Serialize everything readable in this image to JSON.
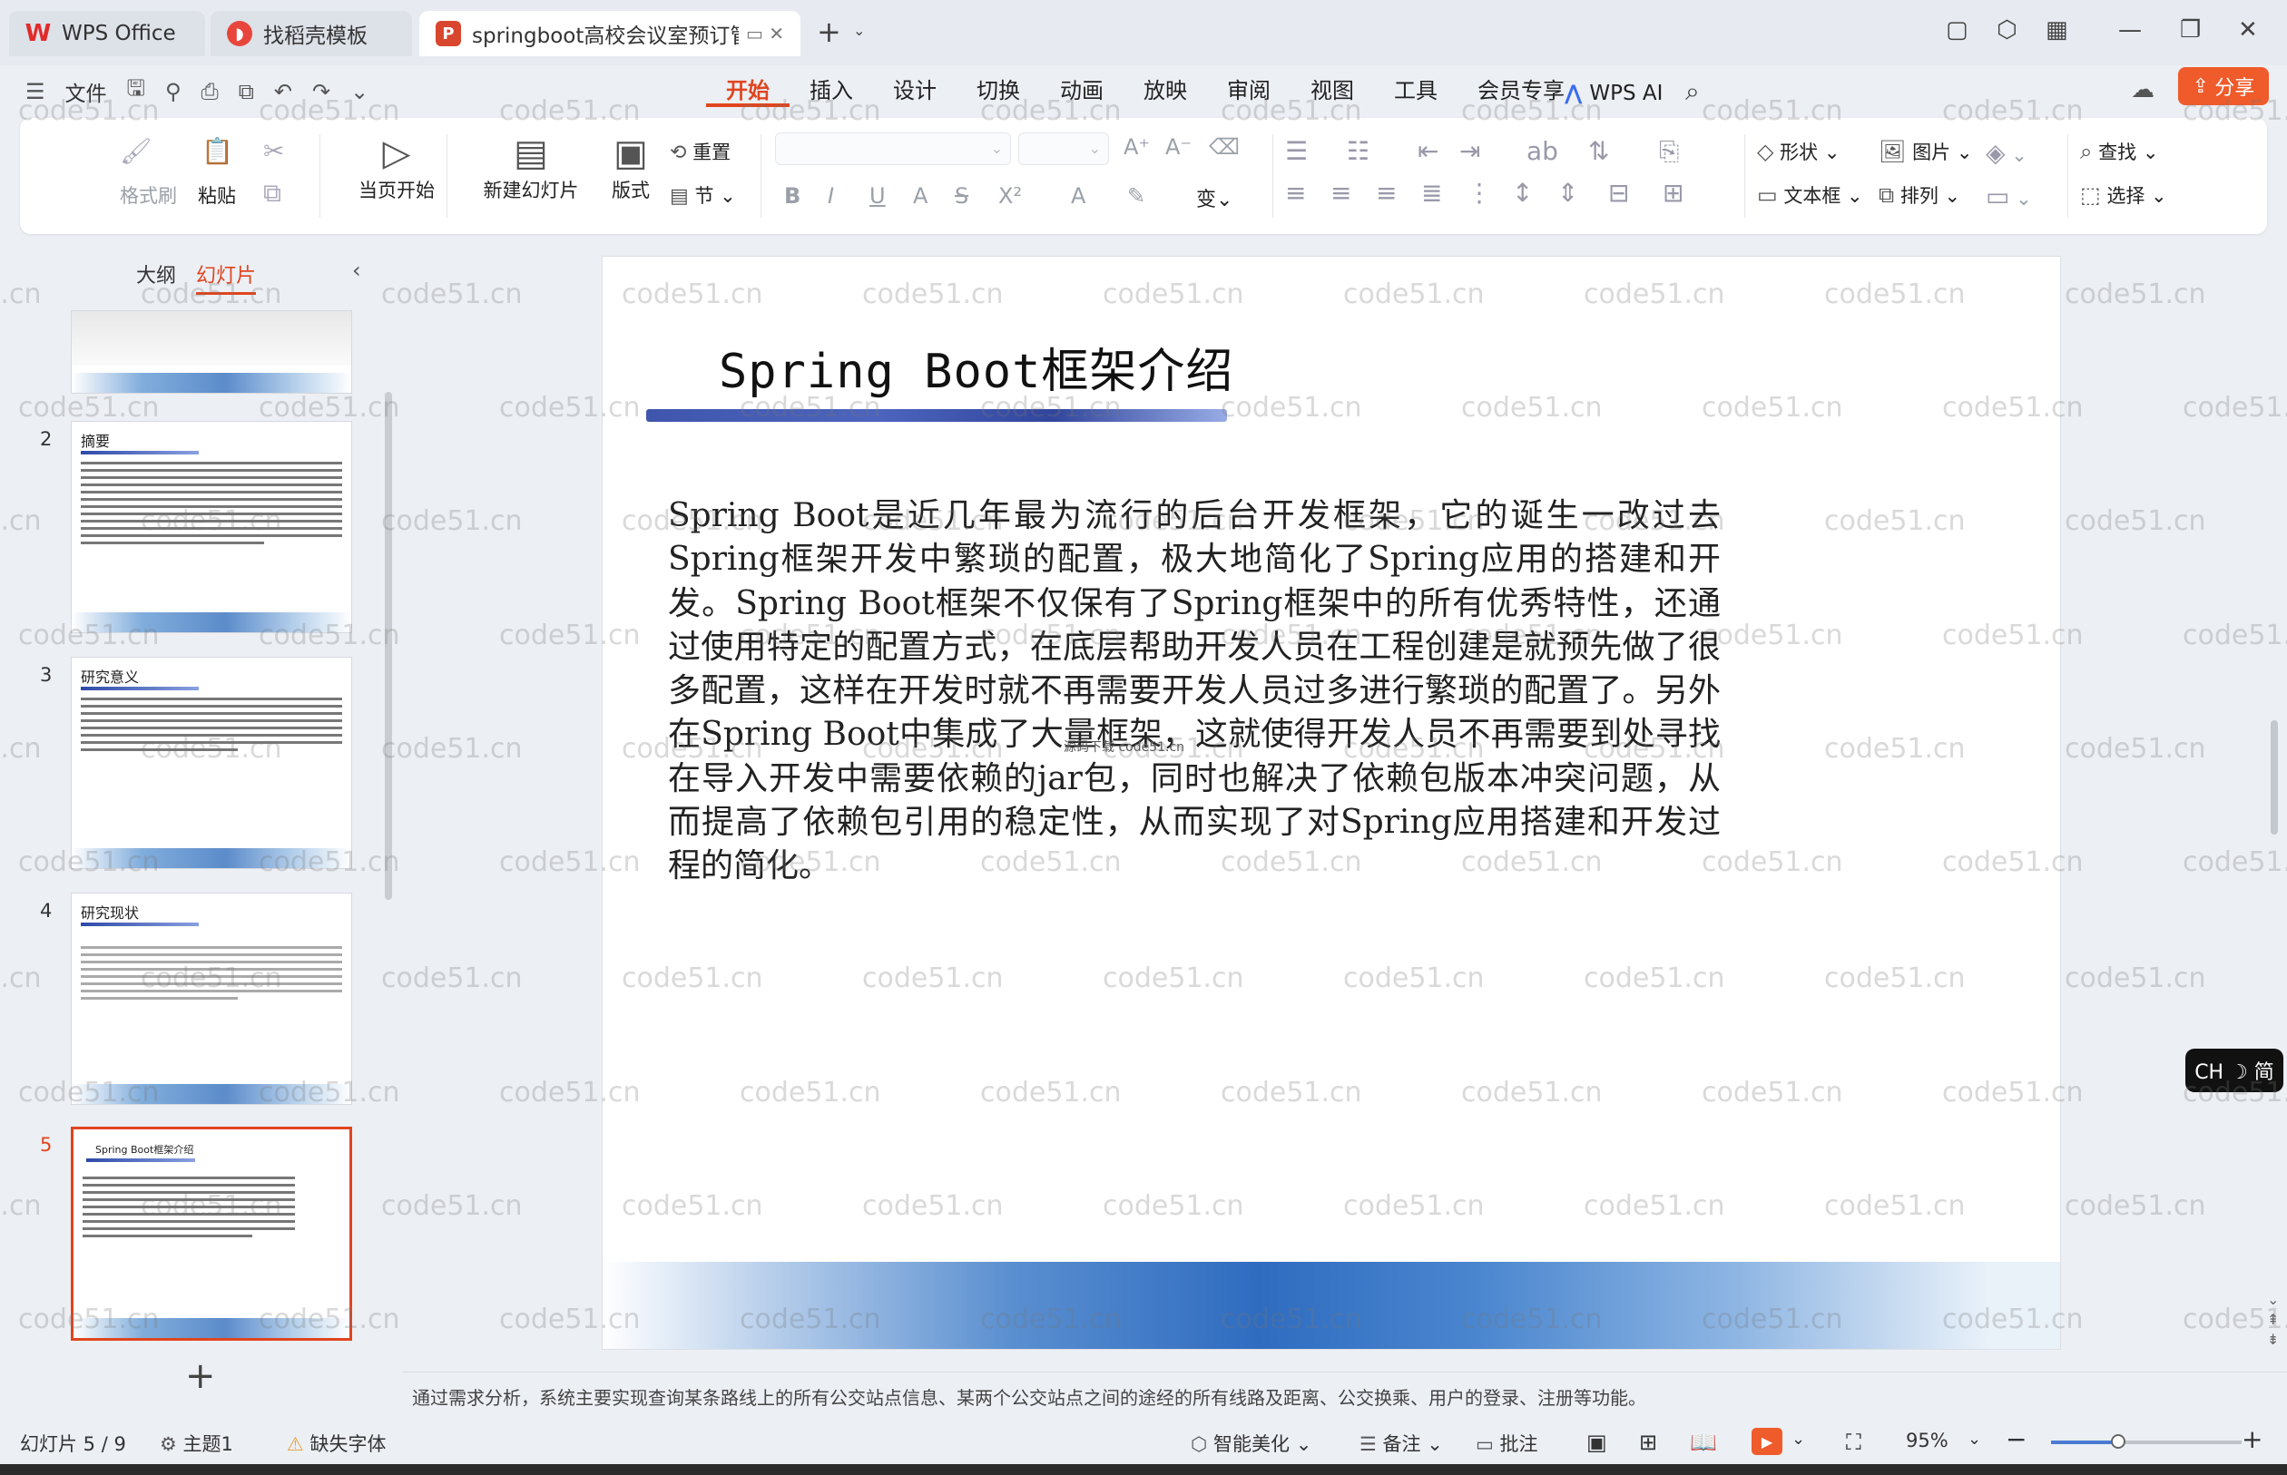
{
  "tabs": [
    {
      "label": "WPS Office"
    },
    {
      "label": "找稻壳模板"
    },
    {
      "label": "springboot高校会议室预订管"
    }
  ],
  "menubar": {
    "file": "文件",
    "items": [
      "开始",
      "插入",
      "设计",
      "切换",
      "动画",
      "放映",
      "审阅",
      "视图",
      "工具",
      "会员专享"
    ],
    "active": "开始",
    "wps_ai": "WPS AI",
    "share": "分享"
  },
  "ribbon": {
    "format_brush": "格式刷",
    "paste": "粘贴",
    "play_from_current": "当页开始",
    "new_slide": "新建幻灯片",
    "layout": "版式",
    "reset": "重置",
    "section": "节",
    "shape": "形状",
    "picture": "图片",
    "find": "查找",
    "textbox": "文本框",
    "arrange": "排列",
    "select": "选择"
  },
  "left_pane": {
    "tabs": [
      "大纲",
      "幻灯片"
    ],
    "active_tab": "幻灯片",
    "thumbnails": [
      {
        "number": "2",
        "title": "摘要"
      },
      {
        "number": "3",
        "title": "研究意义"
      },
      {
        "number": "4",
        "title": "研究现状"
      },
      {
        "number": "5",
        "title": "Spring Boot框架介绍"
      }
    ],
    "selected": "5"
  },
  "slide": {
    "title": "Spring Boot框架介绍",
    "body": "Spring Boot是近几年最为流行的后台开发框架，它的诞生一改过去Spring框架开发中繁琐的配置，极大地简化了Spring应用的搭建和开发。Spring Boot框架不仅保有了Spring框架中的所有优秀特性，还通过使用特定的配置方式，在底层帮助开发人员在工程创建是就预先做了很多配置，这样在开发时就不再需要开发人员过多进行繁琐的配置了。另外在Spring Boot中集成了大量框架，这就使得开发人员不再需要到处寻找在导入开发中需要依赖的jar包，同时也解决了依赖包版本冲突问题，从而提高了依赖包引用的稳定性，从而实现了对Spring应用搭建和开发过程的简化。",
    "inner_watermark": "源码下载 code51.cn"
  },
  "notes": "通过需求分析，系统主要实现查询某条路线上的所有公交站点信息、某两个公交站点之间的途经的所有线路及距离、公交换乘、用户的登录、注册等功能。",
  "statusbar": {
    "slide_counter": "幻灯片 5 / 9",
    "theme": "主题1",
    "missing_font": "缺失字体",
    "smart_beautify": "智能美化",
    "notes": "备注",
    "comments": "批注",
    "zoom": "95%",
    "zoom_fraction": 0.35
  },
  "ime": "CH ☽ 简",
  "watermark": "code51.cn",
  "colors": {
    "accent": "#e0451f",
    "share": "#ef5b2b",
    "slide_bar": "#2f47a6"
  }
}
